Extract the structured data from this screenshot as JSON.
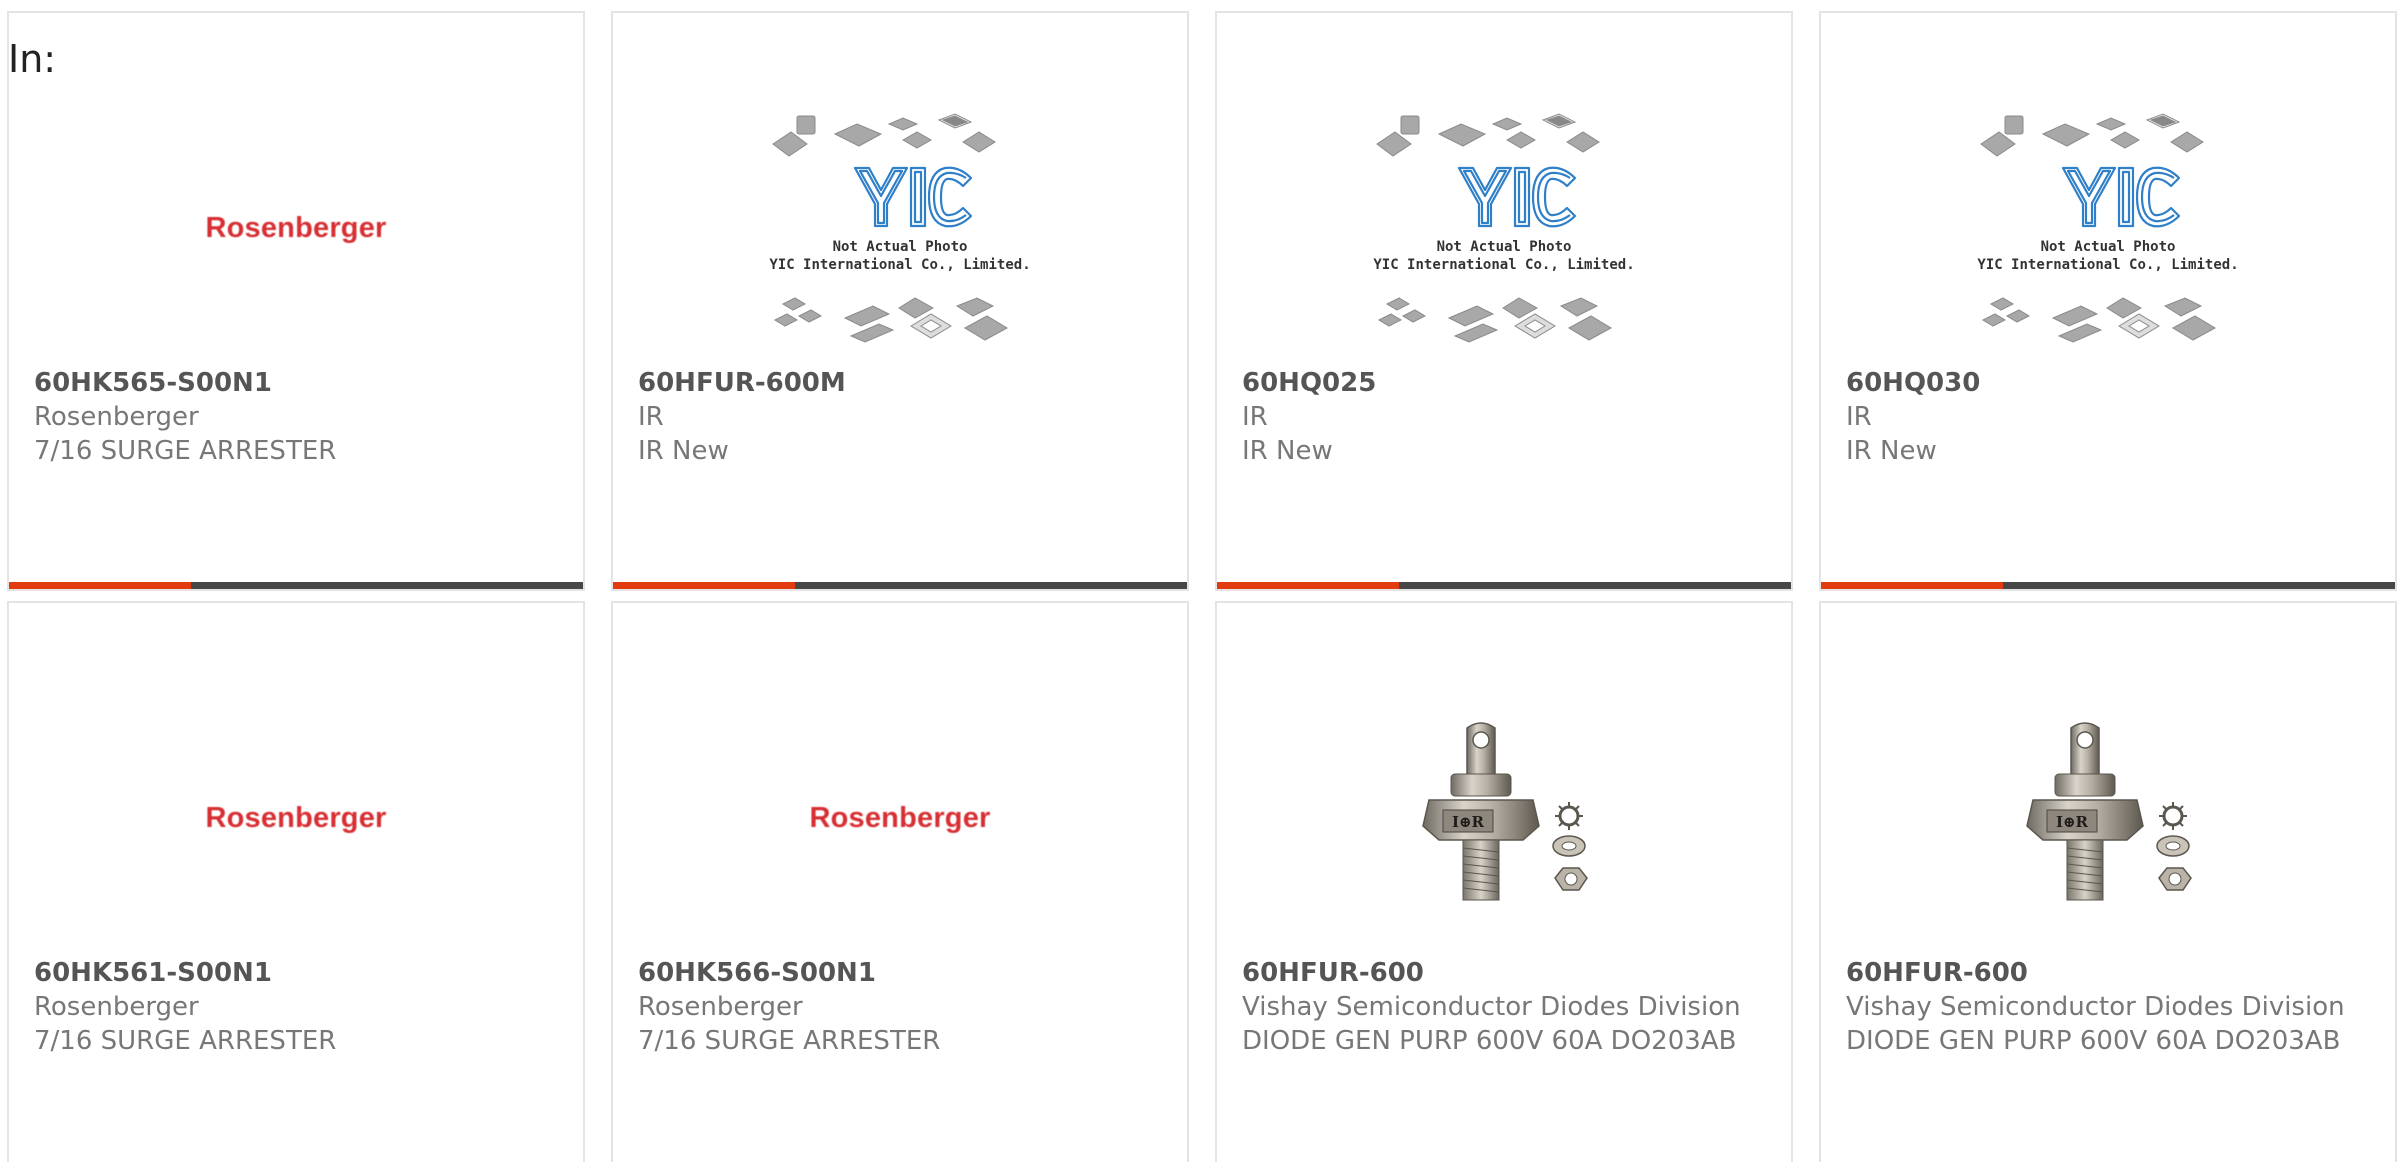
{
  "filter_label": "In:",
  "theme": {
    "accent": "#e33b10",
    "bar": "#474747",
    "border": "#e4e4e4",
    "logo_red": "#d72f33",
    "yic_blue": "#2f7fc9"
  },
  "placeholder_image": {
    "icon": "yic-not-actual-photo-icon",
    "line1": "Not Actual Photo",
    "line2": "YIC International Co., Limited."
  },
  "products": [
    {
      "part": "60HK565-S00N1",
      "manufacturer": "Rosenberger",
      "description": "7/16 SURGE ARRESTER",
      "image": "rosenberger-logo",
      "logo_text": "Rosenberger"
    },
    {
      "part": "60HFUR-600M",
      "manufacturer": "IR",
      "description": "IR New",
      "image": "yic-placeholder"
    },
    {
      "part": "60HQ025",
      "manufacturer": "IR",
      "description": "IR New",
      "image": "yic-placeholder"
    },
    {
      "part": "60HQ030",
      "manufacturer": "IR",
      "description": "IR New",
      "image": "yic-placeholder"
    },
    {
      "part": "60HK561-S00N1",
      "manufacturer": "Rosenberger",
      "description": "7/16 SURGE ARRESTER",
      "image": "rosenberger-logo",
      "logo_text": "Rosenberger"
    },
    {
      "part": "60HK566-S00N1",
      "manufacturer": "Rosenberger",
      "description": "7/16 SURGE ARRESTER",
      "image": "rosenberger-logo",
      "logo_text": "Rosenberger"
    },
    {
      "part": "60HFUR-600",
      "manufacturer": "Vishay Semiconductor Diodes Division",
      "description": "DIODE GEN PURP 600V 60A DO203AB",
      "image": "stud-diode-photo",
      "diode_marking": "I⊕R"
    },
    {
      "part": "60HFUR-600",
      "manufacturer": "Vishay Semiconductor Diodes Division",
      "description": "DIODE GEN PURP 600V 60A DO203AB",
      "image": "stud-diode-photo",
      "diode_marking": "I⊕R"
    }
  ]
}
